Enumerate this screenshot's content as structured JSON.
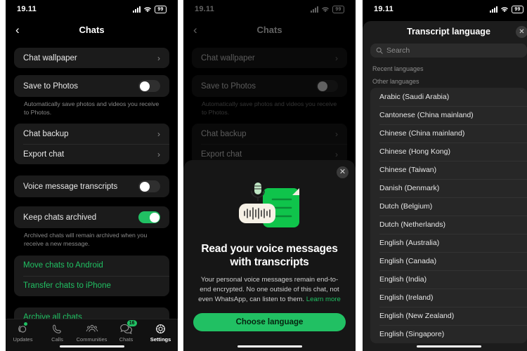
{
  "status_bar": {
    "time": "19.11",
    "battery": "99",
    "signal_icon": "cellular-signal-icon",
    "wifi_icon": "wifi-icon"
  },
  "panel1": {
    "nav": {
      "back_icon": "back-chevron-icon",
      "title": "Chats"
    },
    "groups": [
      {
        "rows": [
          {
            "label": "Chat wallpaper",
            "type": "link"
          }
        ]
      },
      {
        "rows": [
          {
            "label": "Save to Photos",
            "type": "toggle",
            "value": "off"
          }
        ],
        "caption": "Automatically save photos and videos you receive to Photos."
      },
      {
        "rows": [
          {
            "label": "Chat backup",
            "type": "link"
          },
          {
            "label": "Export chat",
            "type": "link"
          }
        ]
      },
      {
        "rows": [
          {
            "label": "Voice message transcripts",
            "type": "toggle",
            "value": "off"
          }
        ]
      },
      {
        "rows": [
          {
            "label": "Keep chats archived",
            "type": "toggle",
            "value": "on"
          }
        ],
        "caption": "Archived chats will remain archived when you receive a new message."
      },
      {
        "rows": [
          {
            "label": "Move chats to Android",
            "type": "action"
          },
          {
            "label": "Transfer chats to iPhone",
            "type": "action"
          }
        ]
      },
      {
        "rows": [
          {
            "label": "Archive all chats",
            "type": "action"
          }
        ]
      }
    ],
    "tabs": [
      {
        "label": "Updates",
        "icon": "updates-icon",
        "active": false,
        "dot": true
      },
      {
        "label": "Calls",
        "icon": "calls-icon",
        "active": false
      },
      {
        "label": "Communities",
        "icon": "communities-icon",
        "active": false
      },
      {
        "label": "Chats",
        "icon": "chats-icon",
        "active": false,
        "badge": "16"
      },
      {
        "label": "Settings",
        "icon": "settings-gear-icon",
        "active": true
      }
    ]
  },
  "panel2": {
    "nav": {
      "back_icon": "back-chevron-icon",
      "title": "Chats"
    },
    "behind_rows": [
      "Chat wallpaper",
      "Save to Photos",
      "Chat backup",
      "Export chat"
    ],
    "behind_caption": "Automatically save photos and videos you receive to Photos.",
    "modal": {
      "close_icon": "close-icon",
      "illustration": "voice-transcript-illustration",
      "title": "Read your voice messages with transcripts",
      "body_prefix": "Your personal voice messages remain end-to-end encrypted. No one outside of this chat, not even WhatsApp, can listen to them. ",
      "link_label": "Learn more",
      "cta_label": "Choose language"
    }
  },
  "panel3": {
    "sheet": {
      "title": "Transcript language",
      "close_icon": "close-icon",
      "search_placeholder": "Search",
      "search_icon": "search-icon",
      "sections": [
        {
          "title": "Recent languages",
          "items": []
        },
        {
          "title": "Other languages",
          "items": [
            "Arabic (Saudi Arabia)",
            "Cantonese (China mainland)",
            "Chinese (China mainland)",
            "Chinese (Hong Kong)",
            "Chinese (Taiwan)",
            "Danish (Denmark)",
            "Dutch (Belgium)",
            "Dutch (Netherlands)",
            "English (Australia)",
            "English (Canada)",
            "English (India)",
            "English (Ireland)",
            "English (New Zealand)",
            "English (Singapore)"
          ]
        }
      ]
    }
  },
  "colors": {
    "accent_green": "#21c063",
    "background": "#000000",
    "card": "#1b1b1b"
  }
}
